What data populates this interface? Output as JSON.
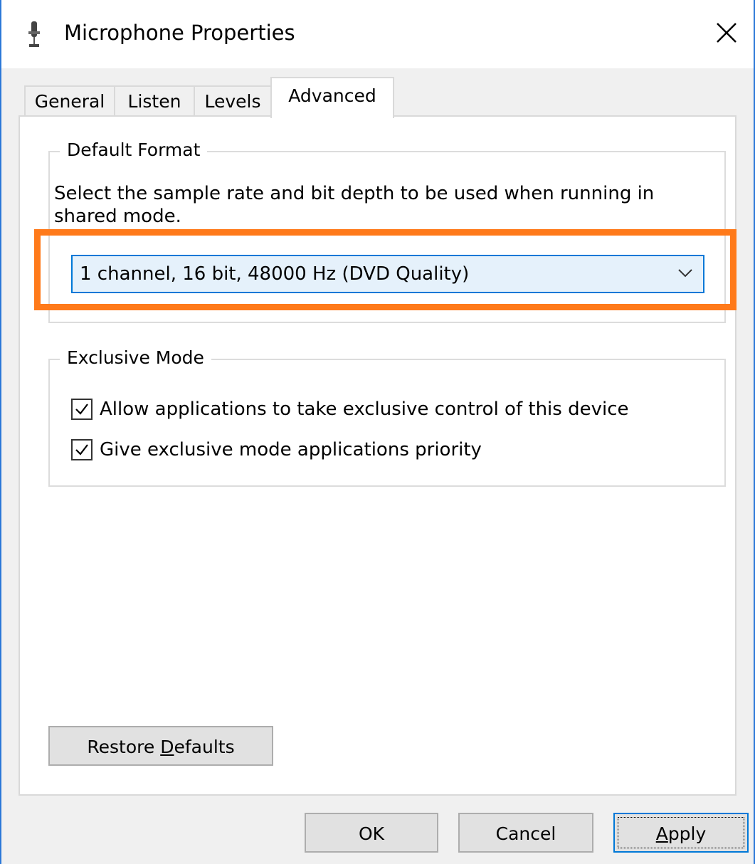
{
  "window": {
    "title": "Microphone Properties",
    "title_icon": "microphone-icon",
    "close_icon": "close-icon"
  },
  "tabs": [
    {
      "label": "General"
    },
    {
      "label": "Listen"
    },
    {
      "label": "Levels"
    },
    {
      "label": "Advanced",
      "active": true
    }
  ],
  "default_format": {
    "group_title": "Default Format",
    "description": "Select the sample rate and bit depth to be used when running in shared mode.",
    "selected_format": "1 channel, 16 bit, 48000 Hz (DVD Quality)",
    "highlight_color": "#ff7a1a"
  },
  "exclusive_mode": {
    "group_title": "Exclusive Mode",
    "options": [
      {
        "label": "Allow applications to take exclusive control of this device",
        "checked": true
      },
      {
        "label": "Give exclusive mode applications priority",
        "checked": true
      }
    ]
  },
  "buttons": {
    "restore_prefix": "Restore ",
    "restore_mnemonic": "D",
    "restore_suffix": "efaults",
    "ok": "OK",
    "cancel": "Cancel",
    "apply_mnemonic": "A",
    "apply_suffix": "pply"
  },
  "colors": {
    "accent": "#0078d7",
    "window_border": "#2b78d8",
    "dialog_bg": "#f0f0f0"
  }
}
